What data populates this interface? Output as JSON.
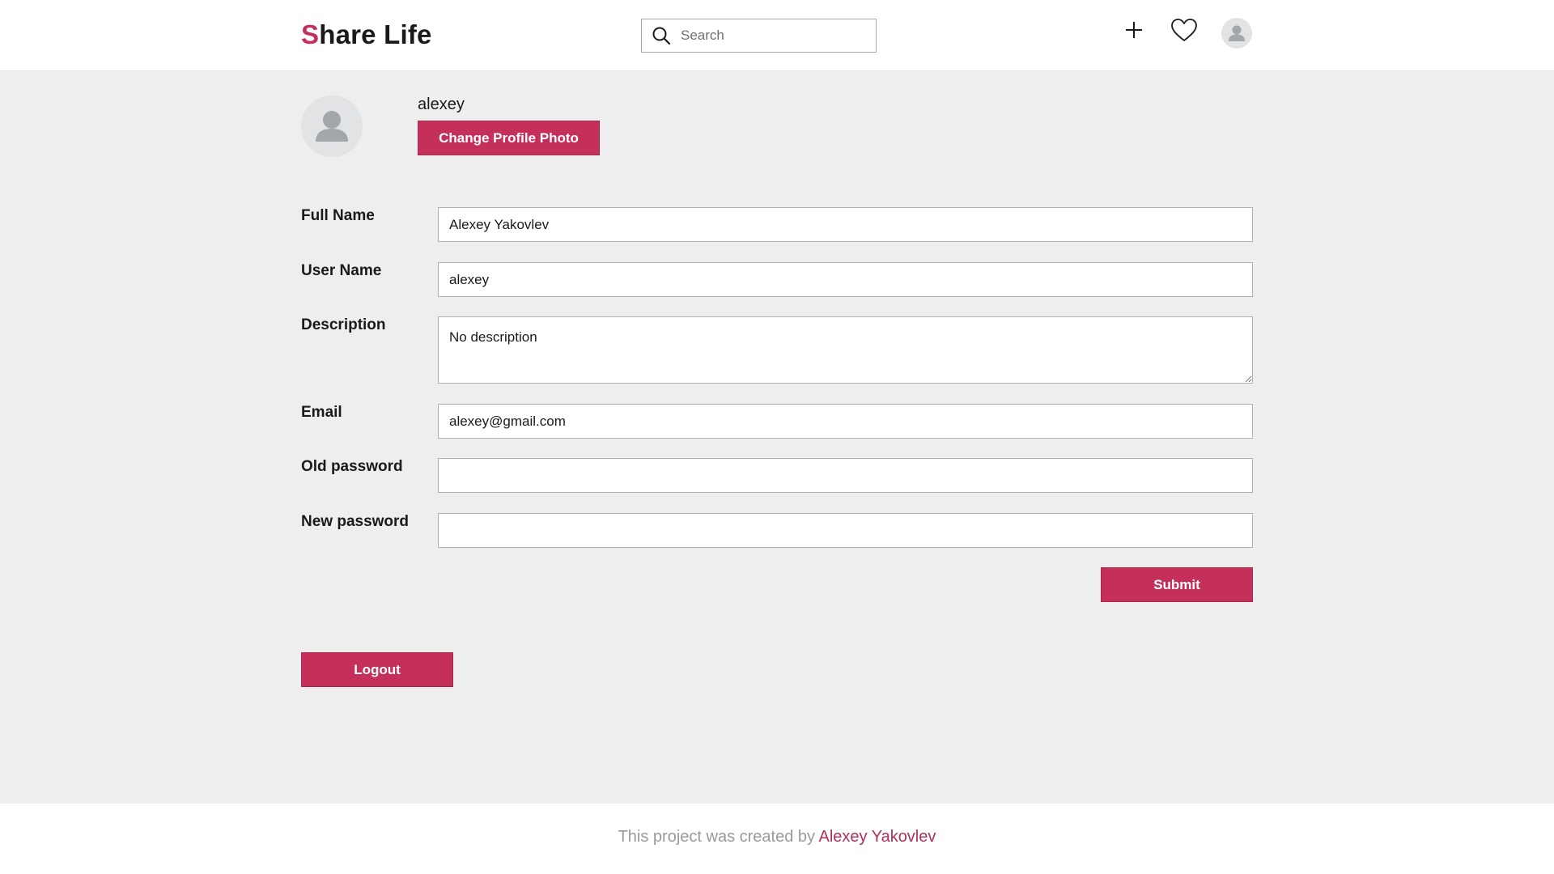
{
  "header": {
    "logo_accent": "S",
    "logo_rest": "hare Life",
    "search_placeholder": "Search",
    "icons": [
      "search-icon",
      "plus-icon",
      "heart-icon",
      "avatar-icon"
    ]
  },
  "profile": {
    "username": "alexey",
    "change_photo_label": "Change Profile Photo"
  },
  "form": {
    "full_name": {
      "label": "Full Name",
      "value": "Alexey Yakovlev"
    },
    "user_name": {
      "label": "User Name",
      "value": "alexey"
    },
    "description": {
      "label": "Description",
      "value": "No description"
    },
    "email": {
      "label": "Email",
      "value": "alexey@gmail.com"
    },
    "old_password": {
      "label": "Old password",
      "value": ""
    },
    "new_password": {
      "label": "New password",
      "value": ""
    },
    "submit_label": "Submit"
  },
  "logout_label": "Logout",
  "footer": {
    "prefix": "This project was created by",
    "author": "Alexey Yakovlev"
  },
  "colors": {
    "accent": "#c4305a",
    "page_background": "#eeeeee",
    "header_background": "#ffffff"
  }
}
